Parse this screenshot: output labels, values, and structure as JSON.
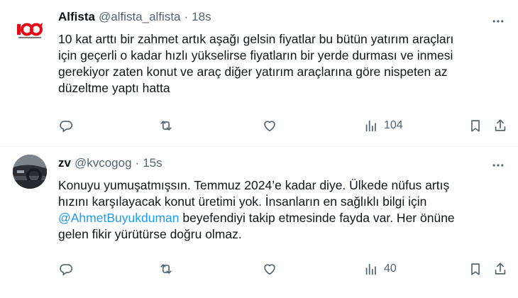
{
  "tweets": [
    {
      "author": {
        "name": "Alfista",
        "handle": "@alfista_alfista"
      },
      "separator": "·",
      "time": "18s",
      "avatar_icon": "100th-anniversary-logo",
      "lines": [
        "10 kat arttı bir zahmet artık aşağı gelsin fiyatlar bu bütün yatırım araçları",
        "için geçerli o kadar hızlı yükselirse fiyatların bir yerde durması ve inmesi",
        "gerekiyor zaten konut ve araç diğer yatırım araçlarına göre nispeten az",
        "düzeltme yaptı hatta"
      ],
      "views": "104"
    },
    {
      "author": {
        "name": "zv",
        "handle": "@kvcogog"
      },
      "separator": "·",
      "time": "15s",
      "avatar_icon": "car-interior-photo",
      "lines": [
        "Konuyu yumuşatmışsın. Temmuz 2024’e kadar diye. Ülkede nüfus artış",
        "hızını karşılayacak konut üretimi yok.  İnsanların en sağlıklı bilgi için"
      ],
      "mention": "@AhmetBuyukduman",
      "line3_rest": " beyefendiyi takip etmesinde fayda var. Her önüne",
      "line4": "gelen fikir yürütürse doğru olmaz.",
      "views": "40"
    }
  ],
  "colors": {
    "text": "#0f1419",
    "secondary": "#536471",
    "link": "#1d9bf0",
    "divider": "#eff3f4",
    "brand_red": "#e30a17"
  }
}
